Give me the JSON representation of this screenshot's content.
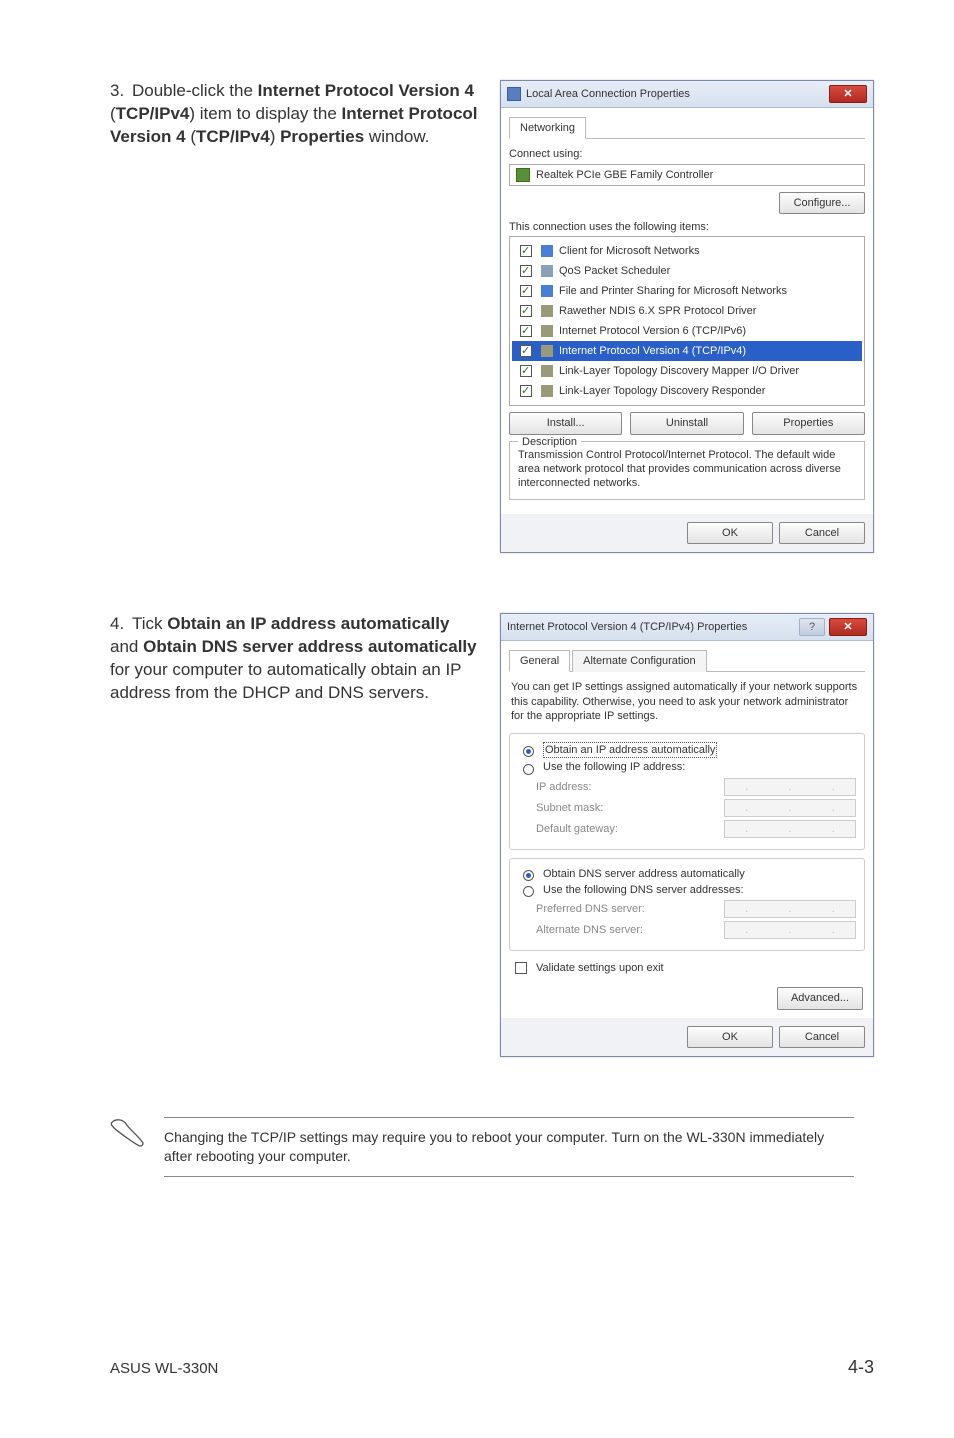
{
  "step3": {
    "num": "3.",
    "t1": "Double-click the ",
    "t2": "Internet Protocol Version 4",
    "t3": " (",
    "t4": "TCP/IPv4",
    "t5": ") item to display the ",
    "t6": "Internet Protocol Version 4",
    "t7": " (",
    "t8": "TCP/IPv4",
    "t9": ") ",
    "t10": "Properties",
    "t11": " window."
  },
  "step4": {
    "num": "4.",
    "t1": "Tick ",
    "t2": "Obtain an IP address automatically",
    "t3": " and ",
    "t4": "Obtain DNS server address automatically",
    "t5": " for your computer to automatically obtain an IP address from the DHCP and DNS servers."
  },
  "dlg1": {
    "title": "Local Area Connection Properties",
    "tab": "Networking",
    "connect_using": "Connect using:",
    "adapter": "Realtek PCIe GBE Family Controller",
    "configure": "Configure...",
    "uses": "This connection uses the following items:",
    "items": [
      "Client for Microsoft Networks",
      "QoS Packet Scheduler",
      "File and Printer Sharing for Microsoft Networks",
      "Rawether NDIS 6.X SPR Protocol Driver",
      "Internet Protocol Version 6 (TCP/IPv6)",
      "Internet Protocol Version 4 (TCP/IPv4)",
      "Link-Layer Topology Discovery Mapper I/O Driver",
      "Link-Layer Topology Discovery Responder"
    ],
    "install": "Install...",
    "uninstall": "Uninstall",
    "properties": "Properties",
    "desc_label": "Description",
    "desc": "Transmission Control Protocol/Internet Protocol. The default wide area network protocol that provides communication across diverse interconnected networks.",
    "ok": "OK",
    "cancel": "Cancel"
  },
  "dlg2": {
    "title": "Internet Protocol Version 4 (TCP/IPv4) Properties",
    "tab_general": "General",
    "tab_alt": "Alternate Configuration",
    "desc": "You can get IP settings assigned automatically if your network supports this capability. Otherwise, you need to ask your network administrator for the appropriate IP settings.",
    "r_auto_ip": "Obtain an IP address automatically",
    "r_use_ip": "Use the following IP address:",
    "ip_address": "IP address:",
    "subnet": "Subnet mask:",
    "gateway": "Default gateway:",
    "r_auto_dns": "Obtain DNS server address automatically",
    "r_use_dns": "Use the following DNS server addresses:",
    "pref_dns": "Preferred DNS server:",
    "alt_dns": "Alternate DNS server:",
    "validate": "Validate settings upon exit",
    "advanced": "Advanced...",
    "ok": "OK",
    "cancel": "Cancel"
  },
  "note": "Changing the TCP/IP settings may require you to reboot your computer. Turn on the WL-330N immediately after rebooting your computer.",
  "footer_left": "ASUS WL-330N",
  "footer_right": "4-3"
}
